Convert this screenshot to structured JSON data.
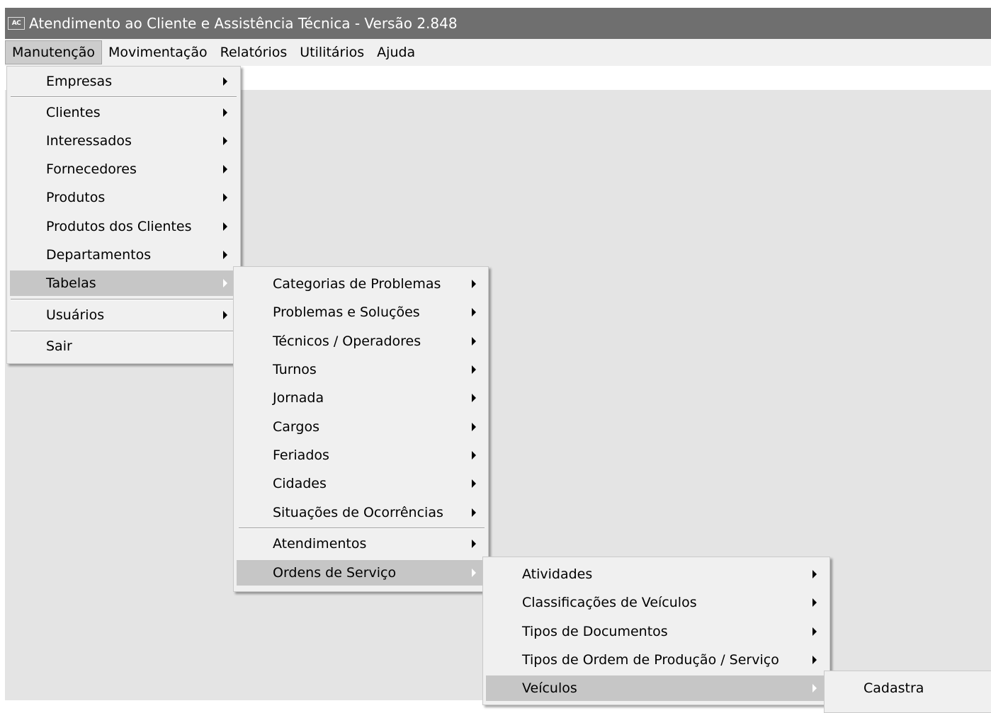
{
  "window": {
    "icon_text": "AC",
    "title": "Atendimento ao Cliente e Assistência Técnica - Versão 2.848"
  },
  "menubar": {
    "items": [
      {
        "label": "Manutenção"
      },
      {
        "label": "Movimentação"
      },
      {
        "label": "Relatórios"
      },
      {
        "label": "Utilitários"
      },
      {
        "label": "Ajuda"
      }
    ]
  },
  "menu_manutencao": {
    "items": [
      {
        "label": "Empresas"
      },
      {
        "label": "Clientes"
      },
      {
        "label": "Interessados"
      },
      {
        "label": "Fornecedores"
      },
      {
        "label": "Produtos"
      },
      {
        "label": "Produtos dos Clientes"
      },
      {
        "label": "Departamentos"
      },
      {
        "label": "Tabelas"
      },
      {
        "label": "Usuários"
      },
      {
        "label": "Sair"
      }
    ]
  },
  "menu_tabelas": {
    "items": [
      {
        "label": "Categorias de Problemas"
      },
      {
        "label": "Problemas e Soluções"
      },
      {
        "label": "Técnicos / Operadores"
      },
      {
        "label": "Turnos"
      },
      {
        "label": "Jornada"
      },
      {
        "label": "Cargos"
      },
      {
        "label": "Feriados"
      },
      {
        "label": "Cidades"
      },
      {
        "label": "Situações de Ocorrências"
      },
      {
        "label": "Atendimentos"
      },
      {
        "label": "Ordens de Serviço"
      }
    ]
  },
  "menu_ordens_servico": {
    "items": [
      {
        "label": "Atividades"
      },
      {
        "label": "Classificações de Veículos"
      },
      {
        "label": "Tipos de Documentos"
      },
      {
        "label": "Tipos de Ordem de Produção / Serviço"
      },
      {
        "label": "Veículos"
      }
    ]
  },
  "menu_veiculos": {
    "items": [
      {
        "label": "Cadastra"
      }
    ]
  },
  "colors": {
    "titlebar": "#6f6f6f",
    "menu_background": "#f0f0f0",
    "menu_highlight": "#c6c6c6",
    "client_area": "#e4e4e4"
  }
}
